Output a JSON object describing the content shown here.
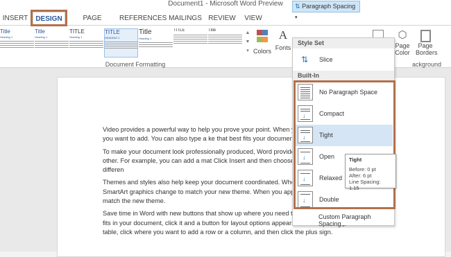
{
  "window": {
    "title": "Document1 - Microsoft Word Preview"
  },
  "tabs": [
    "INSERT",
    "DESIGN",
    "PAGE LAYOUT",
    "REFERENCES",
    "MAILINGS",
    "REVIEW",
    "VIEW"
  ],
  "active_tab": "DESIGN",
  "ribbon": {
    "gallery": [
      {
        "title": "Title",
        "sub": "Heading 1"
      },
      {
        "title": "Title",
        "sub": "Heading 1"
      },
      {
        "title": "TITLE",
        "sub": "Heading 1"
      },
      {
        "title": "TITLE",
        "sub": "HEADING 1"
      },
      {
        "title": "TITLE",
        "sub": ""
      },
      {
        "title": "Title",
        "sub": "Heading 1"
      },
      {
        "title": "Title",
        "sub": ""
      }
    ],
    "group_label_formatting": "Document Formatting",
    "colors_label": "Colors",
    "fonts_label": "Fonts",
    "paragraph_spacing_label": "Paragraph Spacing",
    "page_color_label": "Page Color",
    "page_borders_label": "Page Borders",
    "group_label_background": "ackground"
  },
  "dropdown": {
    "style_set_header": "Style Set",
    "slice_label": "Slice",
    "builtin_header": "Built-In",
    "items": [
      {
        "label": "No Paragraph Space"
      },
      {
        "label": "Compact"
      },
      {
        "label": "Tight"
      },
      {
        "label": "Open"
      },
      {
        "label": "Relaxed"
      },
      {
        "label": "Double"
      }
    ],
    "hovered": "Tight",
    "custom_link": "Custom Paragraph Spacing..."
  },
  "tooltip": {
    "title": "Tight",
    "before": "Before: 0 pt",
    "after": "After: 6 pt",
    "line_spacing": "Line Spacing: 1.15"
  },
  "document": {
    "paragraphs": [
      "Video provides a powerful way to help you prove your point. When you the embed code for the video you want to add. You can also type a ke that best fits your document.",
      "To make your document look professionally produced, Word provides designs that complement each other. For example, you can add a mat Click Insert and then choose the elements you want from the differen",
      "Themes and styles also help keep your document coordinated. When Theme, the pictures, charts, and SmartArt graphics change to match your new theme. When you apply styles, your headings change to match the new theme.",
      "Save time in Word with new buttons that show up where you need them. To change the way a picture fits in your document, click it and a button for layout options appears next to it. When you work on a table, click where you want to add a row or a column, and then click the plus sign."
    ]
  },
  "colors": {
    "accent": "#2b579a",
    "highlight_border": "#b3704a",
    "hover": "#d5e5f5"
  }
}
